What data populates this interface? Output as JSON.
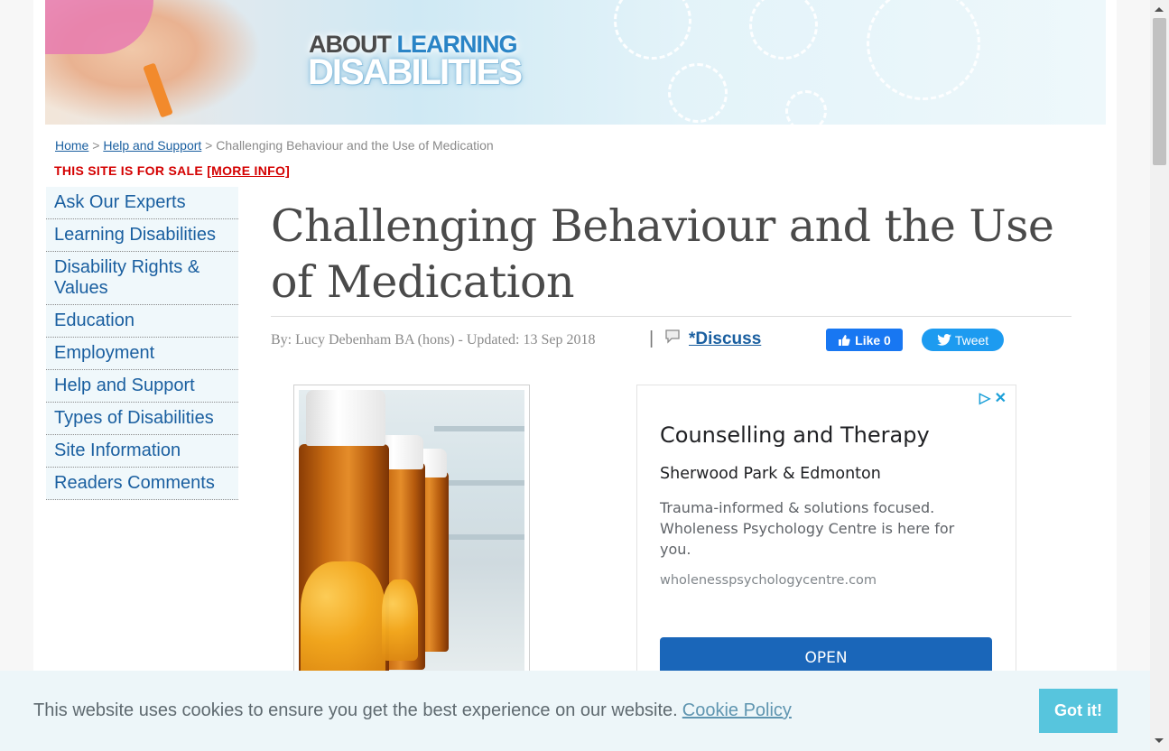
{
  "banner": {
    "logo_line1_a": "ABOUT ",
    "logo_line1_b": "LEARNING",
    "logo_line2": "DISABILITIES"
  },
  "breadcrumb": {
    "home": "Home",
    "sep1": " > ",
    "help": "Help and Support",
    "sep2": " > ",
    "current": "Challenging Behaviour and the Use of Medication"
  },
  "forsale": {
    "text": "THIS SITE IS FOR SALE ",
    "link": "[MORE INFO]"
  },
  "sidebar": {
    "items": [
      {
        "label": "Ask Our Experts"
      },
      {
        "label": "Learning Disabilities"
      },
      {
        "label": "Disability Rights & Values"
      },
      {
        "label": "Education"
      },
      {
        "label": "Employment"
      },
      {
        "label": "Help and Support"
      },
      {
        "label": "Types of Disabilities"
      },
      {
        "label": "Site Information"
      },
      {
        "label": "Readers Comments"
      }
    ]
  },
  "article": {
    "title": "Challenging Behaviour and the Use of Medication",
    "byline": "By: Lucy Debenham BA (hons) - Updated: 13 Sep 2018",
    "pipe": "|",
    "discuss": "*Discuss"
  },
  "social": {
    "fb_label": "Like 0",
    "tw_label": "Tweet",
    "fb_color": "#1877f2",
    "tw_color": "#1d9bf0"
  },
  "ad": {
    "title": "Counselling and Therapy",
    "location": "Sherwood Park & Edmonton",
    "description": "Trauma-informed & solutions focused. Wholeness Psychology Centre is here for you.",
    "url": "wholenesspsychologycentre.com",
    "button": "OPEN",
    "button_color": "#1a66b9"
  },
  "cookie": {
    "message": "This website uses cookies to ensure you get the best experience on our website.",
    "policy_link": "Cookie Policy",
    "button": "Got it!",
    "button_color": "#57c5dd"
  }
}
